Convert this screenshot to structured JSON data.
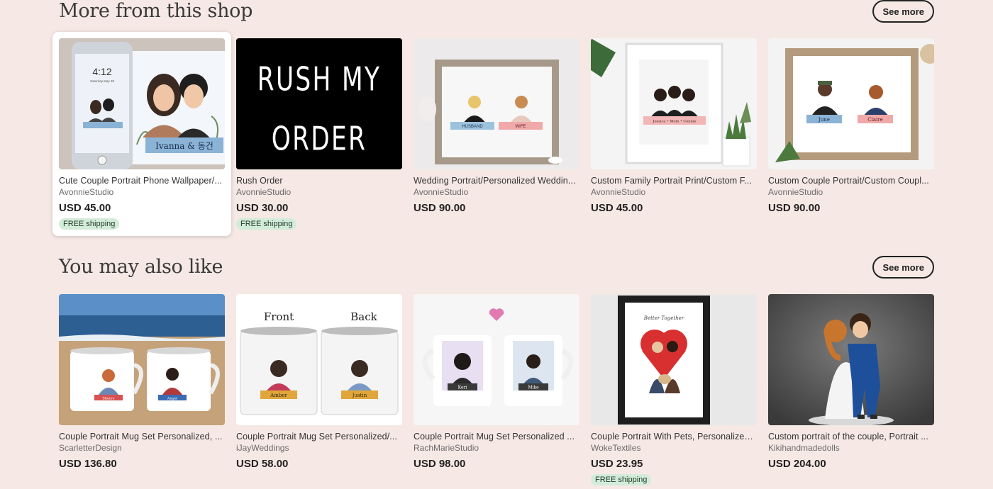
{
  "sections": [
    {
      "title": "More from this shop",
      "see_more": "See more",
      "items": [
        {
          "title": "Cute Couple Portrait Phone Wallpaper/...",
          "shop": "AvonnieStudio",
          "price": "USD 45.00",
          "badge": "FREE shipping",
          "img": {
            "phone_time": "4:12",
            "phone_date": "Saturday May 30",
            "banner": "Ivanna & 동건"
          }
        },
        {
          "title": "Rush Order",
          "shop": "AvonnieStudio",
          "price": "USD 30.00",
          "badge": "FREE shipping",
          "img": {
            "line1": "RUSH MY",
            "line2": "ORDER"
          }
        },
        {
          "title": "Wedding Portrait/Personalized Weddin...",
          "shop": "AvonnieStudio",
          "price": "USD 90.00",
          "img": {
            "left": "HUSBAND",
            "right": "WIFE"
          }
        },
        {
          "title": "Custom Family Portrait Print/Custom F...",
          "shop": "AvonnieStudio",
          "price": "USD 45.00",
          "img": {
            "banner": "Jessica • Mom • Connie"
          }
        },
        {
          "title": "Custom Couple Portrait/Custom Coupl...",
          "shop": "AvonnieStudio",
          "price": "USD 90.00",
          "img": {
            "left": "June",
            "right": "Claire"
          }
        }
      ]
    },
    {
      "title": "You may also like",
      "see_more": "See more",
      "items": [
        {
          "title": "Couple Portrait Mug Set Personalized, ...",
          "shop": "ScarletterDesign",
          "price": "USD 136.80",
          "img": {
            "left": "Sherry",
            "right": "Angel"
          }
        },
        {
          "title": "Couple Portrait Mug Set Personalized/...",
          "shop": "iJayWeddings",
          "price": "USD 58.00",
          "img": {
            "front": "Front",
            "back": "Back",
            "left": "Amber",
            "right": "Justin"
          }
        },
        {
          "title": "Couple Portrait Mug Set Personalized ...",
          "shop": "RachMarieStudio",
          "price": "USD 98.00",
          "img": {
            "left": "Keri",
            "right": "Mike"
          }
        },
        {
          "title": "Couple Portrait With Pets, Personalized...",
          "shop": "WokeTextiles",
          "price": "USD 23.95",
          "badge": "FREE shipping",
          "img": {
            "heading": "Better Together"
          }
        },
        {
          "title": "Custom portrait of the couple, Portrait ...",
          "shop": "Kikihandmadedolls",
          "price": "USD 204.00"
        }
      ]
    }
  ]
}
